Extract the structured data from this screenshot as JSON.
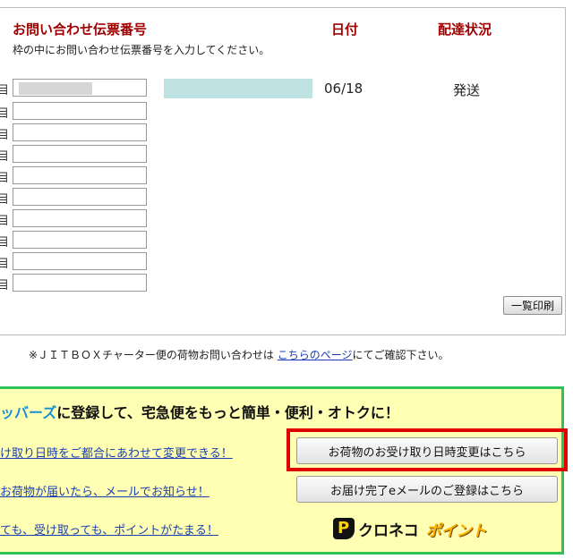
{
  "table": {
    "headers": {
      "number": "お問い合わせ伝票番号",
      "date": "日付",
      "status": "配達状況"
    },
    "instruction": "枠の中にお問い合わせ伝票番号を入力してください。",
    "row_mark": "目",
    "first_row": {
      "date": "06/18",
      "status": "発送"
    },
    "print_button": "一覧印刷"
  },
  "note": {
    "before": "※ＪＩＴＢＯＸチャーター便の荷物お問い合わせは ",
    "link": "こちらのページ",
    "after": "にてご確認下さい。"
  },
  "promo": {
    "title_highlight": "ッバーズ",
    "title_rest": "に登録して、宅急便をもっと簡単・便利・オトクに！",
    "link1": "け取り日時をご都合にあわせて変更できる！",
    "link2": "お荷物が届いたら、メールでお知らせ！",
    "link3": "ても、受け取っても、ポイントがたまる！",
    "button1": "お荷物のお受け取り日時変更はこちら",
    "button2": "お届け完了eメールのご登録はこちら",
    "logo_mark": "P",
    "logo_text": "クロネコ",
    "logo_point": "ポイント"
  },
  "colors": {
    "header_red": "#a00000",
    "highlight_red": "#e00000",
    "promo_bg": "#ffffb3",
    "promo_border": "#2fc25a",
    "link_blue": "#1a3fb5"
  }
}
